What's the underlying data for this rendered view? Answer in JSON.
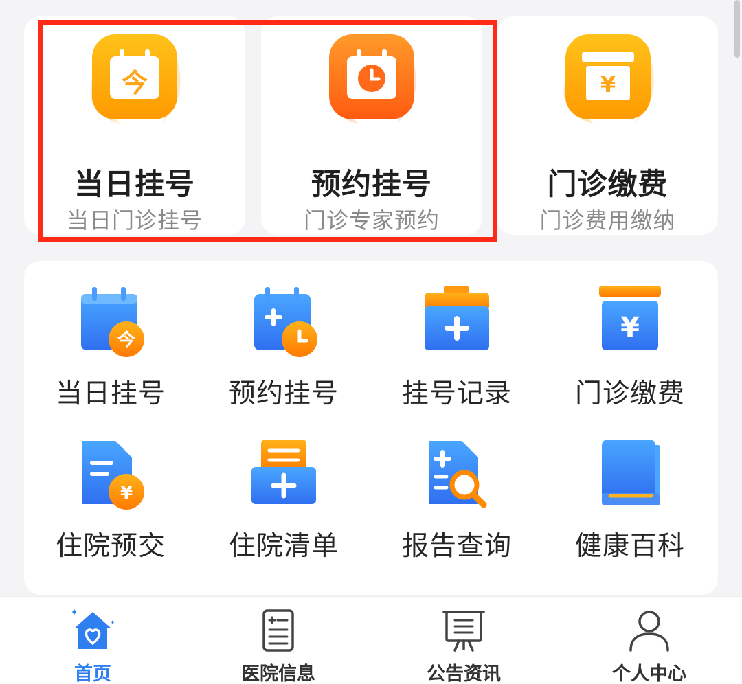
{
  "cards": [
    {
      "title": "当日挂号",
      "subtitle": "当日门诊挂号",
      "icon": "calendar-today-icon",
      "glyph": "今"
    },
    {
      "title": "预约挂号",
      "subtitle": "门诊专家预约",
      "icon": "calendar-clock-icon"
    },
    {
      "title": "门诊缴费",
      "subtitle": "门诊费用缴纳",
      "icon": "payment-box-icon",
      "glyph": "¥"
    }
  ],
  "grid": [
    {
      "label": "当日挂号",
      "icon": "calendar-today-icon",
      "glyph": "今"
    },
    {
      "label": "预约挂号",
      "icon": "calendar-clock-icon"
    },
    {
      "label": "挂号记录",
      "icon": "medical-folder-icon"
    },
    {
      "label": "门诊缴费",
      "icon": "payment-box-icon",
      "glyph": "¥"
    },
    {
      "label": "住院预交",
      "icon": "deposit-document-icon",
      "glyph": "¥"
    },
    {
      "label": "住院清单",
      "icon": "inpatient-list-icon"
    },
    {
      "label": "报告查询",
      "icon": "report-search-icon"
    },
    {
      "label": "健康百科",
      "icon": "health-book-icon"
    }
  ],
  "nav": [
    {
      "label": "首页",
      "icon": "home-heart-icon",
      "active": true
    },
    {
      "label": "医院信息",
      "icon": "hospital-info-icon",
      "active": false
    },
    {
      "label": "公告资讯",
      "icon": "announcement-board-icon",
      "active": false
    },
    {
      "label": "个人中心",
      "icon": "person-icon",
      "active": false
    }
  ],
  "colors": {
    "accent_blue": "#2f7ff0",
    "accent_orange": "#ff8a00",
    "highlight_red": "#ff2a18",
    "background": "#f4f4f6"
  }
}
